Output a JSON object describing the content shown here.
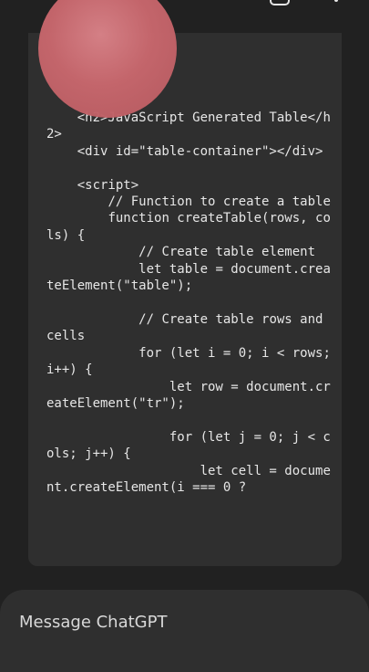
{
  "code_block": {
    "text": "    <h2>JavaScript Generated Table</h2>\n    <div id=\"table-container\"></div>\n\n    <script>\n        // Function to create a table\n        function createTable(rows, cols) {\n            // Create table element\n            let table = document.createElement(\"table\");\n\n            // Create table rows and cells\n            for (let i = 0; i < rows; i++) {\n                let row = document.createElement(\"tr\");\n\n                for (let j = 0; j < cols; j++) {\n                    let cell = document.createElement(i === 0 ?"
  },
  "composer": {
    "placeholder": "Message ChatGPT"
  },
  "icons": {
    "menu": "hamburger-menu-icon",
    "new_chat": "new-chat-icon",
    "more": "more-options-icon"
  }
}
